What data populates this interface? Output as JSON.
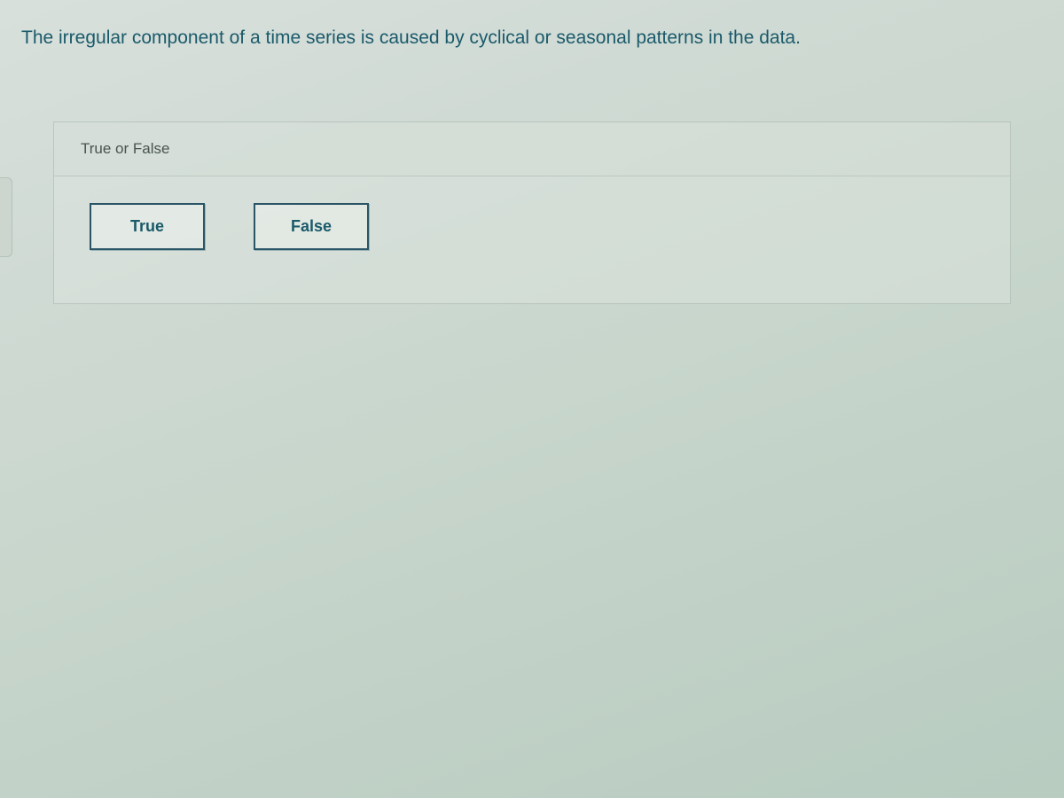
{
  "question": {
    "prompt": "The irregular component of a time series is caused by cyclical or seasonal patterns in the data."
  },
  "panel": {
    "header": "True or False",
    "options": {
      "true_label": "True",
      "false_label": "False"
    }
  }
}
